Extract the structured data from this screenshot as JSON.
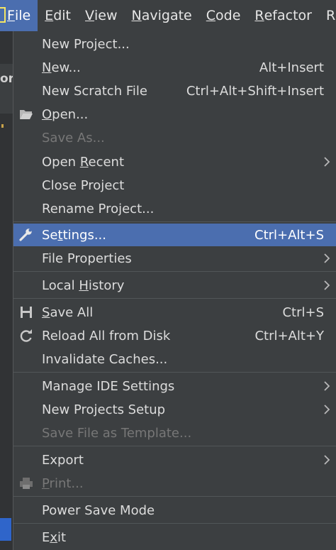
{
  "menubar": {
    "items": [
      {
        "pre": "",
        "mn": "F",
        "post": "ile"
      },
      {
        "pre": "",
        "mn": "E",
        "post": "dit"
      },
      {
        "pre": "",
        "mn": "V",
        "post": "iew"
      },
      {
        "pre": "",
        "mn": "N",
        "post": "avigate"
      },
      {
        "pre": "",
        "mn": "C",
        "post": "ode"
      },
      {
        "pre": "",
        "mn": "R",
        "post": "efactor"
      },
      {
        "pre": "",
        "mn": "",
        "post": "R"
      }
    ]
  },
  "background": {
    "left_fragment": "orc"
  },
  "file_menu": {
    "new_project": {
      "pre": "New Project...",
      "mn": "",
      "post": ""
    },
    "new": {
      "pre": "",
      "mn": "N",
      "post": "ew...",
      "shortcut": "Alt+Insert"
    },
    "new_scratch": {
      "pre": "New Scratch File",
      "mn": "",
      "post": "",
      "shortcut": "Ctrl+Alt+Shift+Insert"
    },
    "open": {
      "pre": "",
      "mn": "O",
      "post": "pen..."
    },
    "save_as": {
      "pre": "Save As...",
      "mn": "",
      "post": ""
    },
    "open_recent": {
      "pre": "Open ",
      "mn": "R",
      "post": "ecent"
    },
    "close_project": {
      "pre": "Close Project",
      "mn": "",
      "post": ""
    },
    "rename_project": {
      "pre": "Rename Project...",
      "mn": "",
      "post": ""
    },
    "settings": {
      "pre": "Se",
      "mn": "t",
      "post": "tings...",
      "shortcut": "Ctrl+Alt+S"
    },
    "file_properties": {
      "pre": "File Properties",
      "mn": "",
      "post": ""
    },
    "local_history": {
      "pre": "Local ",
      "mn": "H",
      "post": "istory"
    },
    "save_all": {
      "pre": "",
      "mn": "S",
      "post": "ave All",
      "shortcut": "Ctrl+S"
    },
    "reload": {
      "pre": "Reload All from Disk",
      "mn": "",
      "post": "",
      "shortcut": "Ctrl+Alt+Y"
    },
    "invalidate": {
      "pre": "Invalidate Caches...",
      "mn": "",
      "post": ""
    },
    "manage_ide": {
      "pre": "Manage IDE Settings",
      "mn": "",
      "post": ""
    },
    "new_projects_setup": {
      "pre": "New Projects Setup",
      "mn": "",
      "post": ""
    },
    "save_template": {
      "pre": "Save File as Template...",
      "mn": "",
      "post": ""
    },
    "export": {
      "pre": "Export",
      "mn": "",
      "post": ""
    },
    "print": {
      "pre": "",
      "mn": "P",
      "post": "rint..."
    },
    "power_save": {
      "pre": "Power Save Mode",
      "mn": "",
      "post": ""
    },
    "exit": {
      "pre": "E",
      "mn": "x",
      "post": "it"
    }
  },
  "colors": {
    "menubar_bg": "#3c3f41",
    "menu_bg": "#3c3f41",
    "selection": "#4b6eaf",
    "text": "#dcdcdc",
    "disabled_text": "#777777",
    "separator": "#515658"
  },
  "icons": {
    "open": "folder-icon",
    "settings": "wrench-icon",
    "save_all": "floppy-disk-icon",
    "reload": "refresh-icon",
    "print": "printer-icon",
    "submenu": "chevron-right-icon"
  }
}
